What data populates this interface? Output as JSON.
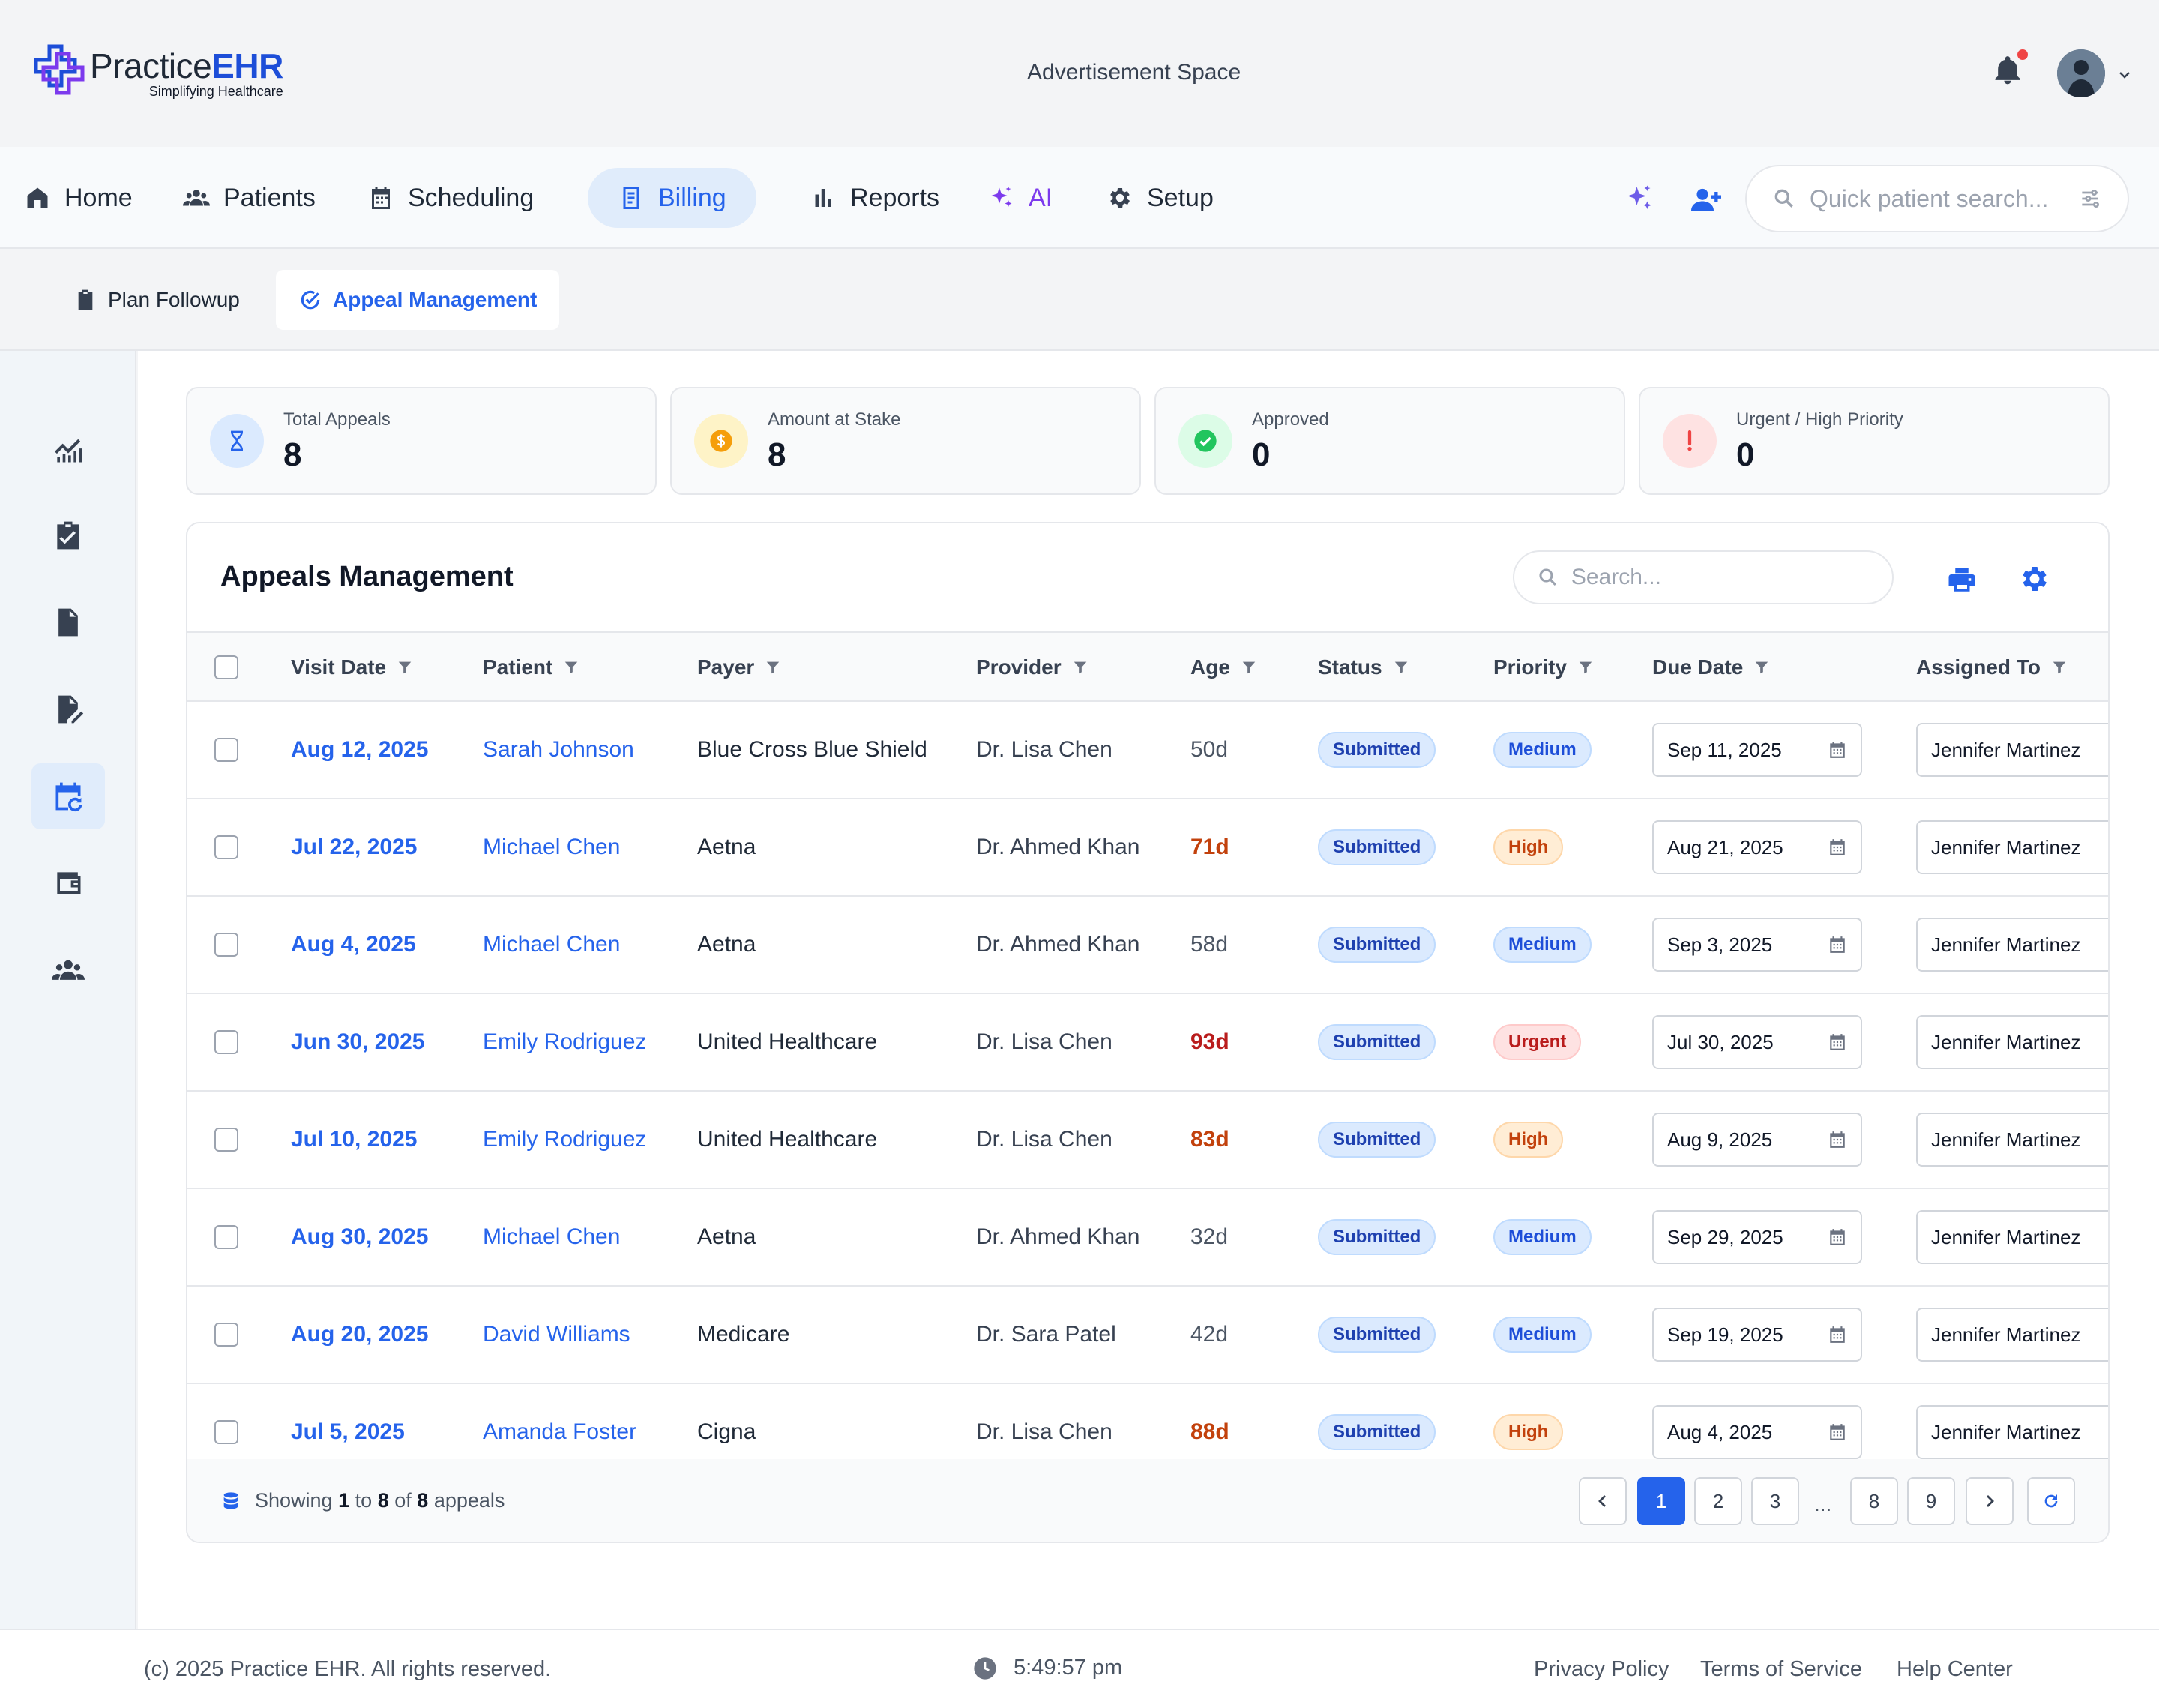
{
  "header": {
    "logo_prefix": "Practice",
    "logo_brand": "EHR",
    "logo_tagline": "Simplifying Healthcare",
    "advertisement": "Advertisement Space"
  },
  "nav": {
    "items": [
      {
        "label": "Home",
        "icon": "home-icon"
      },
      {
        "label": "Patients",
        "icon": "patients-icon"
      },
      {
        "label": "Scheduling",
        "icon": "calendar-icon"
      },
      {
        "label": "Billing",
        "icon": "billing-icon",
        "active": true
      },
      {
        "label": "Reports",
        "icon": "bar-chart-icon"
      },
      {
        "label": "AI",
        "icon": "sparkle-icon"
      },
      {
        "label": "Setup",
        "icon": "gear-icon"
      }
    ],
    "quick_search_placeholder": "Quick patient search..."
  },
  "subtabs": [
    {
      "label": "Plan Followup",
      "icon": "clipboard-icon"
    },
    {
      "label": "Appeal Management",
      "icon": "check-circle-icon",
      "active": true
    }
  ],
  "sidebar": [
    {
      "icon": "analytics-icon"
    },
    {
      "icon": "clipboard-check-icon"
    },
    {
      "icon": "document-icon"
    },
    {
      "icon": "document-edit-icon"
    },
    {
      "icon": "calendar-refresh-icon",
      "active": true
    },
    {
      "icon": "wallet-icon"
    },
    {
      "icon": "group-icon"
    }
  ],
  "stats": [
    {
      "label": "Total Appeals",
      "value": "8",
      "icon": "hourglass-icon",
      "color": "#2563eb",
      "bg": "#dbeafe"
    },
    {
      "label": "Amount at Stake",
      "value": "8",
      "icon": "dollar-coin-icon",
      "color": "#f59e0b",
      "bg": "#fef3c7"
    },
    {
      "label": "Approved",
      "value": "0",
      "icon": "check-circle-icon",
      "color": "#22c55e",
      "bg": "#dcfce7"
    },
    {
      "label": "Urgent / High Priority",
      "value": "0",
      "icon": "exclamation-icon",
      "color": "#ef4444",
      "bg": "#fee2e2"
    }
  ],
  "panel": {
    "title": "Appeals Management",
    "search_placeholder": "Search..."
  },
  "table": {
    "columns": [
      "Visit Date",
      "Patient",
      "Payer",
      "Provider",
      "Age",
      "Status",
      "Priority",
      "Due Date",
      "Assigned To"
    ],
    "rows": [
      {
        "visit_date": "Aug 12, 2025",
        "patient": "Sarah Johnson",
        "payer": "Blue Cross Blue Shield",
        "provider": "Dr. Lisa Chen",
        "age": "50d",
        "age_level": "normal",
        "status": "Submitted",
        "priority": "Medium",
        "due_date": "Sep 11, 2025",
        "assigned_to": "Jennifer Martinez"
      },
      {
        "visit_date": "Jul 22, 2025",
        "patient": "Michael Chen",
        "payer": "Aetna",
        "provider": "Dr. Ahmed Khan",
        "age": "71d",
        "age_level": "warn",
        "status": "Submitted",
        "priority": "High",
        "due_date": "Aug 21, 2025",
        "assigned_to": "Jennifer Martinez"
      },
      {
        "visit_date": "Aug 4, 2025",
        "patient": "Michael Chen",
        "payer": "Aetna",
        "provider": "Dr. Ahmed Khan",
        "age": "58d",
        "age_level": "normal",
        "status": "Submitted",
        "priority": "Medium",
        "due_date": "Sep 3, 2025",
        "assigned_to": "Jennifer Martinez"
      },
      {
        "visit_date": "Jun 30, 2025",
        "patient": "Emily Rodriguez",
        "payer": "United Healthcare",
        "provider": "Dr. Lisa Chen",
        "age": "93d",
        "age_level": "crit",
        "status": "Submitted",
        "priority": "Urgent",
        "due_date": "Jul 30, 2025",
        "assigned_to": "Jennifer Martinez"
      },
      {
        "visit_date": "Jul 10, 2025",
        "patient": "Emily Rodriguez",
        "payer": "United Healthcare",
        "provider": "Dr. Lisa Chen",
        "age": "83d",
        "age_level": "warn",
        "status": "Submitted",
        "priority": "High",
        "due_date": "Aug 9, 2025",
        "assigned_to": "Jennifer Martinez"
      },
      {
        "visit_date": "Aug 30, 2025",
        "patient": "Michael Chen",
        "payer": "Aetna",
        "provider": "Dr. Ahmed Khan",
        "age": "32d",
        "age_level": "normal",
        "status": "Submitted",
        "priority": "Medium",
        "due_date": "Sep 29, 2025",
        "assigned_to": "Jennifer Martinez"
      },
      {
        "visit_date": "Aug 20, 2025",
        "patient": "David Williams",
        "payer": "Medicare",
        "provider": "Dr. Sara Patel",
        "age": "42d",
        "age_level": "normal",
        "status": "Submitted",
        "priority": "Medium",
        "due_date": "Sep 19, 2025",
        "assigned_to": "Jennifer Martinez"
      },
      {
        "visit_date": "Jul 5, 2025",
        "patient": "Amanda Foster",
        "payer": "Cigna",
        "provider": "Dr. Lisa Chen",
        "age": "88d",
        "age_level": "warn",
        "status": "Submitted",
        "priority": "High",
        "due_date": "Aug 4, 2025",
        "assigned_to": "Jennifer Martinez"
      }
    ]
  },
  "pagination": {
    "showing_prefix": "Showing",
    "from": "1",
    "to_word": "to",
    "to": "8",
    "of_word": "of",
    "total": "8",
    "suffix": "appeals",
    "pages": [
      "1",
      "2",
      "3",
      "...",
      "8",
      "9"
    ],
    "current": "1"
  },
  "footer": {
    "copyright": "(c) 2025 Practice EHR. All rights reserved.",
    "time": "5:49:57 pm",
    "links": [
      "Privacy Policy",
      "Terms of Service",
      "Help Center"
    ]
  }
}
